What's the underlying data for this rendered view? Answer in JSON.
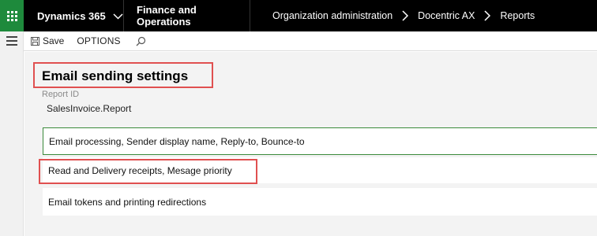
{
  "topbar": {
    "brand": "Dynamics 365",
    "module": "Finance and Operations",
    "breadcrumb": [
      "Organization administration",
      "Docentric AX",
      "Reports"
    ]
  },
  "actionbar": {
    "save_label": "Save",
    "options_label": "OPTIONS"
  },
  "page": {
    "title": "Email sending settings",
    "report_id_label": "Report ID",
    "report_id_value": "SalesInvoice.Report"
  },
  "sections": [
    "Email processing, Sender display name, Reply-to, Bounce-to",
    "Read and Delivery receipts, Mesage priority",
    "Email tokens and printing redirections"
  ],
  "colors": {
    "app_launcher": "#1e8a3c",
    "highlight": "#e05050",
    "focus_border": "#3a8a3a"
  }
}
